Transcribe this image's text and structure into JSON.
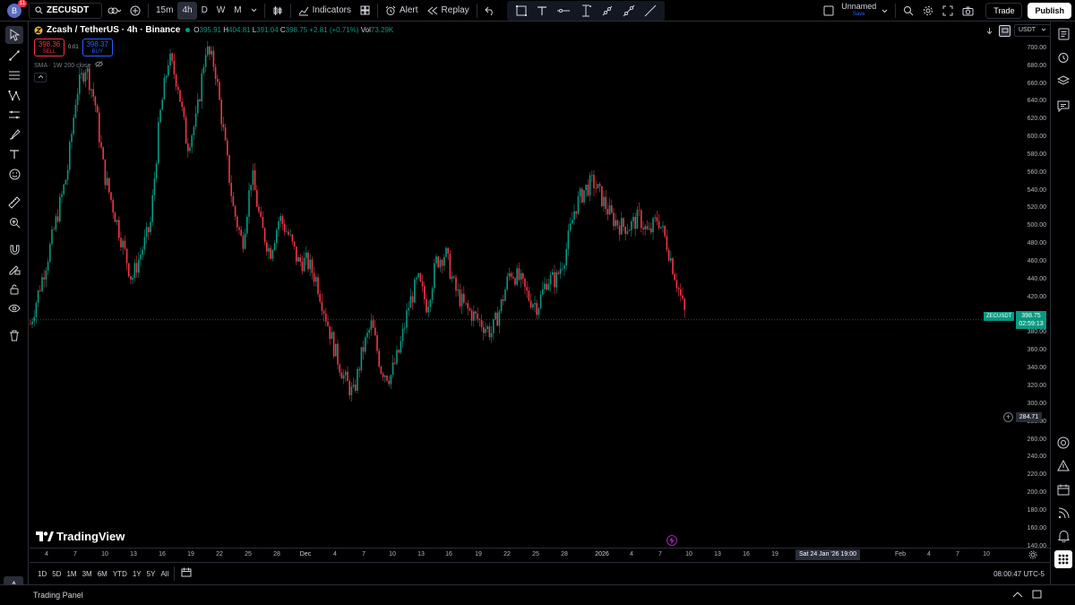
{
  "top": {
    "avatar_letter": "B",
    "notif_count": "11",
    "symbol": "ZECUSDT",
    "intervals": [
      "15m",
      "4h",
      "D",
      "W",
      "M"
    ],
    "active_interval": "4h",
    "indicators_label": "Indicators",
    "alert_label": "Alert",
    "replay_label": "Replay",
    "layout_name": "Unnamed",
    "save_label": "Save",
    "trade_label": "Trade",
    "publish_label": "Publish"
  },
  "legend": {
    "title": "Zcash / TetherUS · 4h · Binance",
    "open_k": "O",
    "open": "395.91",
    "high_k": "H",
    "high": "404.81",
    "low_k": "L",
    "low": "391.04",
    "close_k": "C",
    "close": "398.75",
    "change": "+2.81 (+0.71%)",
    "vol_k": "Vol",
    "vol": "73.29K",
    "sell_price": "398.36",
    "sell_label": "SELL",
    "spread": "0.01",
    "buy_price": "398.37",
    "buy_label": "BUY",
    "sma": "SMA · 1W 200 close"
  },
  "axis": {
    "currency": "USDT",
    "price_labels": [
      "700.00",
      "680.00",
      "660.00",
      "640.00",
      "620.00",
      "600.00",
      "580.00",
      "560.00",
      "540.00",
      "520.00",
      "500.00",
      "480.00",
      "460.00",
      "440.00",
      "420.00",
      "400.00",
      "380.00",
      "360.00",
      "340.00",
      "320.00",
      "300.00",
      "280.00",
      "260.00",
      "240.00",
      "220.00",
      "200.00",
      "180.00",
      "160.00",
      "140.00"
    ],
    "last_symbol": "ZECUSDT",
    "last_price": "398.75",
    "countdown": "02:59:13",
    "cross_price": "284.71",
    "time_labels": [
      "4",
      "7",
      "10",
      "13",
      "16",
      "19",
      "22",
      "25",
      "28",
      "Dec",
      "4",
      "7",
      "10",
      "13",
      "16",
      "19",
      "22",
      "25",
      "28",
      "2026",
      "4",
      "7",
      "10",
      "13",
      "16",
      "19",
      "Sat 24 Jan '26   19:00",
      "Feb",
      "4",
      "7",
      "10"
    ],
    "hover_date": "Sat 24 Jan '26   19:00"
  },
  "bottom": {
    "ranges": [
      "1D",
      "5D",
      "1M",
      "3M",
      "6M",
      "YTD",
      "1Y",
      "5Y",
      "All"
    ],
    "clock": "08:00:47 UTC-5",
    "trading_panel": "Trading Panel",
    "brand": "TradingView"
  },
  "chart_data": {
    "type": "candlestick",
    "symbol": "ZECUSDT",
    "interval": "4h",
    "ylim": [
      140,
      710
    ],
    "x_labels": [
      "4",
      "7",
      "10",
      "13",
      "16",
      "19",
      "22",
      "25",
      "28",
      "Dec",
      "4",
      "7",
      "10",
      "13",
      "16",
      "19",
      "22",
      "25",
      "28",
      "2026",
      "4",
      "7",
      "10",
      "13",
      "16",
      "19",
      "Feb",
      "4",
      "7",
      "10"
    ],
    "close_path": [
      [
        0,
        390
      ],
      [
        2,
        470
      ],
      [
        4,
        560
      ],
      [
        5,
        650
      ],
      [
        6,
        680
      ],
      [
        7,
        640
      ],
      [
        8,
        560
      ],
      [
        9,
        520
      ],
      [
        10,
        480
      ],
      [
        11,
        440
      ],
      [
        12,
        470
      ],
      [
        13,
        500
      ],
      [
        14,
        620
      ],
      [
        15,
        690
      ],
      [
        16,
        660
      ],
      [
        17,
        590
      ],
      [
        18,
        620
      ],
      [
        19,
        700
      ],
      [
        20,
        680
      ],
      [
        21,
        600
      ],
      [
        22,
        520
      ],
      [
        23,
        480
      ],
      [
        24,
        560
      ],
      [
        25,
        500
      ],
      [
        26,
        470
      ],
      [
        27,
        510
      ],
      [
        28,
        490
      ],
      [
        29,
        460
      ],
      [
        30,
        460
      ],
      [
        31,
        440
      ],
      [
        32,
        400
      ],
      [
        33,
        360
      ],
      [
        34,
        330
      ],
      [
        35,
        310
      ],
      [
        36,
        360
      ],
      [
        37,
        390
      ],
      [
        38,
        340
      ],
      [
        39,
        330
      ],
      [
        40,
        360
      ],
      [
        41,
        410
      ],
      [
        42,
        440
      ],
      [
        43,
        410
      ],
      [
        44,
        460
      ],
      [
        45,
        470
      ],
      [
        46,
        430
      ],
      [
        47,
        410
      ],
      [
        48,
        400
      ],
      [
        49,
        390
      ],
      [
        50,
        380
      ],
      [
        51,
        410
      ],
      [
        52,
        450
      ],
      [
        53,
        440
      ],
      [
        54,
        420
      ],
      [
        55,
        410
      ],
      [
        56,
        440
      ],
      [
        57,
        440
      ],
      [
        58,
        470
      ],
      [
        59,
        520
      ],
      [
        60,
        540
      ],
      [
        61,
        550
      ],
      [
        62,
        530
      ],
      [
        63,
        510
      ],
      [
        64,
        500
      ],
      [
        65,
        500
      ],
      [
        66,
        510
      ],
      [
        67,
        490
      ],
      [
        68,
        510
      ],
      [
        69,
        480
      ],
      [
        70,
        440
      ],
      [
        71,
        398.75
      ]
    ],
    "last_price": 398.75
  }
}
